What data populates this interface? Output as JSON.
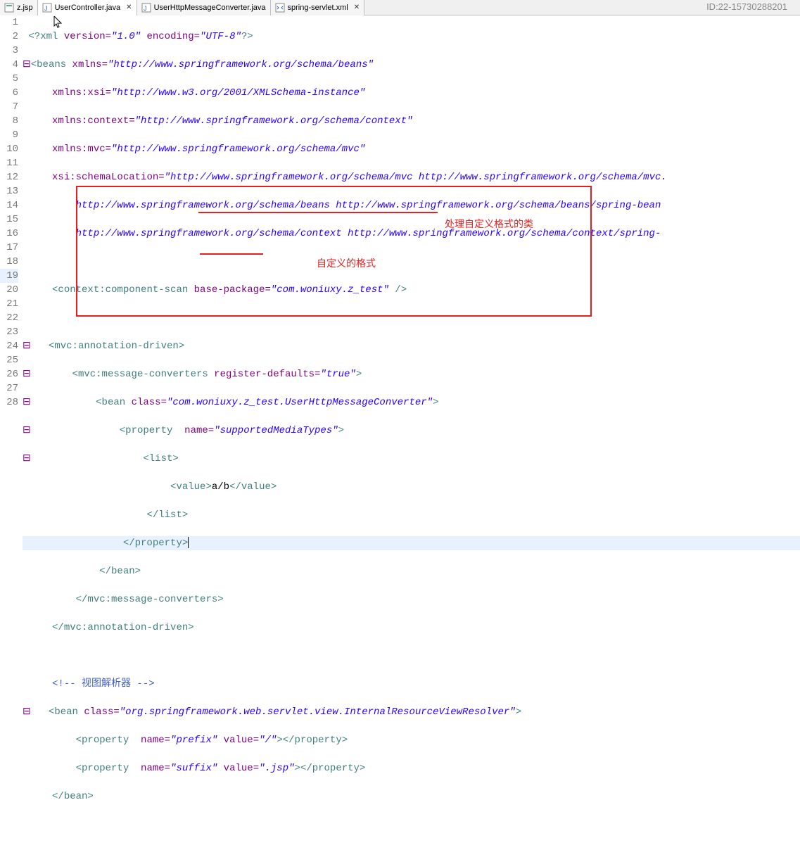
{
  "tabs": {
    "t0": "z.jsp",
    "t1": "UserController.java",
    "t2": "UserHttpMessageConverter.java",
    "t3": "spring-servlet.xml"
  },
  "id_mark": "ID:22-15730288201",
  "lines": {
    "l1": "1",
    "l2": "2",
    "l3": "3",
    "l4": "4",
    "l5": "5",
    "l6": "6",
    "l7": "7",
    "l8": "8",
    "l9": "9",
    "l10": "10",
    "l11": "11",
    "l12": "12",
    "l13": "13",
    "l14": "14",
    "l15": "15",
    "l16": "16",
    "l17": "17",
    "l18": "18",
    "l19": "19",
    "l20": "20",
    "l21": "21",
    "l22": "22",
    "l23": "23",
    "l24": "24",
    "l25": "25",
    "l26": "26",
    "l27": "27",
    "l28": "28"
  },
  "code": {
    "xml_decl_open": "<?xml",
    "xml_version_attr": " version=",
    "xml_version_val": "\"1.0\"",
    "xml_encoding_attr": " encoding=",
    "xml_encoding_val": "\"UTF-8\"",
    "xml_decl_close": "?>",
    "beans_open": "<beans",
    "xmlns_attr": " xmlns=",
    "xmlns_val": "\"http://www.springframework.org/schema/beans\"",
    "xmlns_xsi_attr": "xmlns:xsi=",
    "xmlns_xsi_val": "\"http://www.w3.org/2001/XMLSchema-instance\"",
    "xmlns_ctx_attr": "xmlns:context=",
    "xmlns_ctx_val": "\"http://www.springframework.org/schema/context\"",
    "xmlns_mvc_attr": "xmlns:mvc=",
    "xmlns_mvc_val": "\"http://www.springframework.org/schema/mvc\"",
    "xsi_attr": "xsi:schemaLocation=",
    "xsi_val1": "\"http://www.springframework.org/schema/mvc http://www.springframework.org/schema/mvc.",
    "xsi_val2": "http://www.springframework.org/schema/beans http://www.springframework.org/schema/beans/spring-bean",
    "xsi_val3": "http://www.springframework.org/schema/context http://www.springframework.org/schema/context/spring-",
    "ctx_scan_open": "<context:component-scan",
    "base_pkg_attr": " base-package=",
    "base_pkg_val": "\"com.woniuxy.z_test\"",
    "self_close": " />",
    "mvc_ann_open": "<mvc:annotation-driven>",
    "mvc_ann_close": "</mvc:annotation-driven>",
    "mvc_conv_open": "<mvc:message-converters",
    "reg_def_attr": " register-defaults=",
    "reg_def_val": "\"true\"",
    "gt": ">",
    "bean_open": "<bean",
    "class_attr": " class=",
    "class_val": "\"com.woniuxy.z_test.UserHttpMessageConverter\"",
    "prop_open": "<property ",
    "name_attr": " name=",
    "name_val_smt": "\"supportedMediaTypes\"",
    "list_open": "<list>",
    "list_close": "</list>",
    "value_open": "<value>",
    "value_txt": "a/b",
    "value_close": "</value>",
    "prop_close": "</property>",
    "bean_close": "</bean>",
    "mvc_conv_close": "</mvc:message-converters>",
    "comment": "<!-- 视图解析器 -->",
    "bean2_class_val": "\"org.springframework.web.servlet.view.InternalResourceViewResolver\"",
    "name_prefix": "\"prefix\"",
    "value_attr": " value=",
    "prefix_val": "\"/\"",
    "prop_close2": "></property>",
    "name_suffix": "\"suffix\"",
    "suffix_val": "\".jsp\"",
    "bean_close2": "</bean>"
  },
  "annotations": {
    "label1": "处理自定义格式的类",
    "label2": "自定义的格式"
  }
}
